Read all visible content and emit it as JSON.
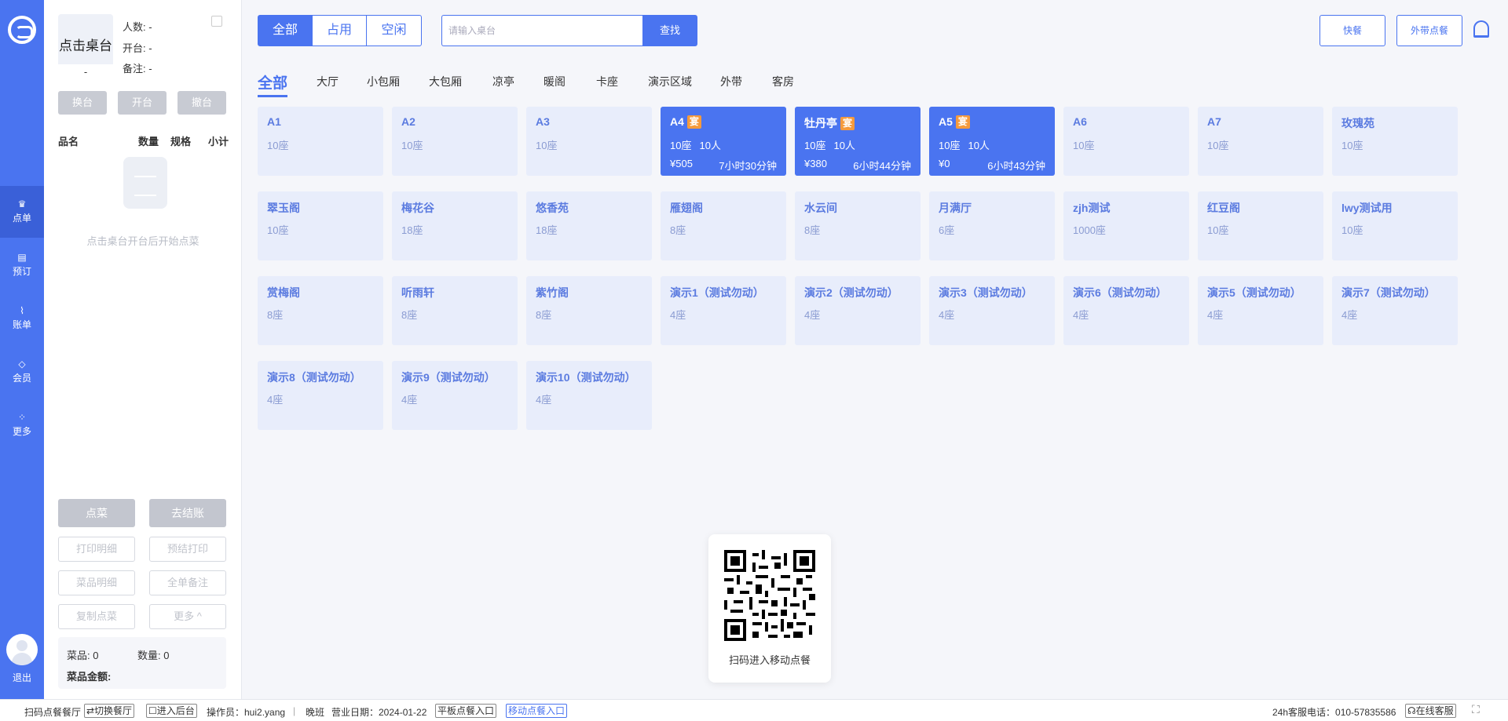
{
  "nav": {
    "items": [
      {
        "label": "点单",
        "icon": "crown-icon"
      },
      {
        "label": "预订",
        "icon": "calendar-icon"
      },
      {
        "label": "账单",
        "icon": "chart-icon"
      },
      {
        "label": "会员",
        "icon": "diamond-icon"
      },
      {
        "label": "更多",
        "icon": "grid-icon"
      }
    ],
    "logout": "退出"
  },
  "order": {
    "table_name": "点击桌台",
    "table_sub": "-",
    "people": "人数: -",
    "open_time": "开台: -",
    "remark": "备注: -",
    "btn_change": "换台",
    "btn_open": "开台",
    "btn_cancel": "撤台",
    "col_name": "品名",
    "col_qty": "数量",
    "col_spec": "规格",
    "col_subtotal": "小计",
    "empty_hint": "点击桌台开台后开始点菜",
    "btn_order": "点菜",
    "btn_checkout": "去结账",
    "btn_print_detail": "打印明细",
    "btn_pre_print": "预结打印",
    "btn_dish_detail": "菜品明细",
    "btn_full_remark": "全单备注",
    "btn_copy": "复制点菜",
    "btn_more": "更多 ^",
    "dish_count": "菜品: 0",
    "qty_count": "数量: 0",
    "amount": "菜品金额:"
  },
  "filters": {
    "all": "全部",
    "occupied": "占用",
    "free": "空闲"
  },
  "search": {
    "placeholder": "请输入桌台",
    "button": "查找"
  },
  "top_buttons": {
    "quick": "快餐",
    "takeout": "外带点餐"
  },
  "zones": [
    "全部",
    "大厅",
    "小包厢",
    "大包厢",
    "凉亭",
    "暖阁",
    "卡座",
    "演示区域",
    "外带",
    "客房"
  ],
  "tables": [
    {
      "name": "A1",
      "seats": "10座"
    },
    {
      "name": "A2",
      "seats": "10座"
    },
    {
      "name": "A3",
      "seats": "10座"
    },
    {
      "name": "A4",
      "seats": "10座",
      "occupied": true,
      "tag": "宴",
      "people": "10人",
      "amount": "¥505",
      "duration": "7小时30分钟"
    },
    {
      "name": "牡丹亭",
      "seats": "10座",
      "occupied": true,
      "tag": "宴",
      "people": "10人",
      "amount": "¥380",
      "duration": "6小时44分钟"
    },
    {
      "name": "A5",
      "seats": "10座",
      "occupied": true,
      "tag": "宴",
      "people": "10人",
      "amount": "¥0",
      "duration": "6小时43分钟"
    },
    {
      "name": "A6",
      "seats": "10座"
    },
    {
      "name": "A7",
      "seats": "10座"
    },
    {
      "name": "玫瑰苑",
      "seats": "10座"
    },
    {
      "name": "翠玉阁",
      "seats": "10座"
    },
    {
      "name": "梅花谷",
      "seats": "18座"
    },
    {
      "name": "悠香苑",
      "seats": "18座"
    },
    {
      "name": "雁翅阁",
      "seats": "8座"
    },
    {
      "name": "水云间",
      "seats": "8座"
    },
    {
      "name": "月满厅",
      "seats": "6座"
    },
    {
      "name": "zjh测试",
      "seats": "1000座"
    },
    {
      "name": "红豆阁",
      "seats": "10座"
    },
    {
      "name": "lwy测试用",
      "seats": "10座"
    },
    {
      "name": "赏梅阁",
      "seats": "8座"
    },
    {
      "name": "听雨轩",
      "seats": "8座"
    },
    {
      "name": "紫竹阁",
      "seats": "8座"
    },
    {
      "name": "演示1（测试勿动）",
      "seats": "4座"
    },
    {
      "name": "演示2（测试勿动）",
      "seats": "4座"
    },
    {
      "name": "演示3（测试勿动）",
      "seats": "4座"
    },
    {
      "name": "演示6（测试勿动）",
      "seats": "4座"
    },
    {
      "name": "演示5（测试勿动）",
      "seats": "4座"
    },
    {
      "name": "演示7（测试勿动）",
      "seats": "4座"
    },
    {
      "name": "演示8（测试勿动）",
      "seats": "4座"
    },
    {
      "name": "演示9（测试勿动）",
      "seats": "4座"
    },
    {
      "name": "演示10（测试勿动）",
      "seats": "4座"
    }
  ],
  "qr": {
    "caption": "扫码进入移动点餐"
  },
  "status": {
    "restaurant": "扫码点餐餐厅",
    "switch": "⇄切换餐厅",
    "backend": "☐进入后台",
    "operator": "操作员：hui2.yang",
    "shift": "晚班",
    "biz_date": "营业日期：2024-01-22",
    "tablet": "平板点餐入口",
    "mobile": "移动点餐入口",
    "hotline": "24h客服电话：010-57835586",
    "online": "在线客服"
  },
  "colors": {
    "primary": "#4a74f0",
    "tag": "#f59a3c",
    "card_free": "#e8edfb"
  }
}
